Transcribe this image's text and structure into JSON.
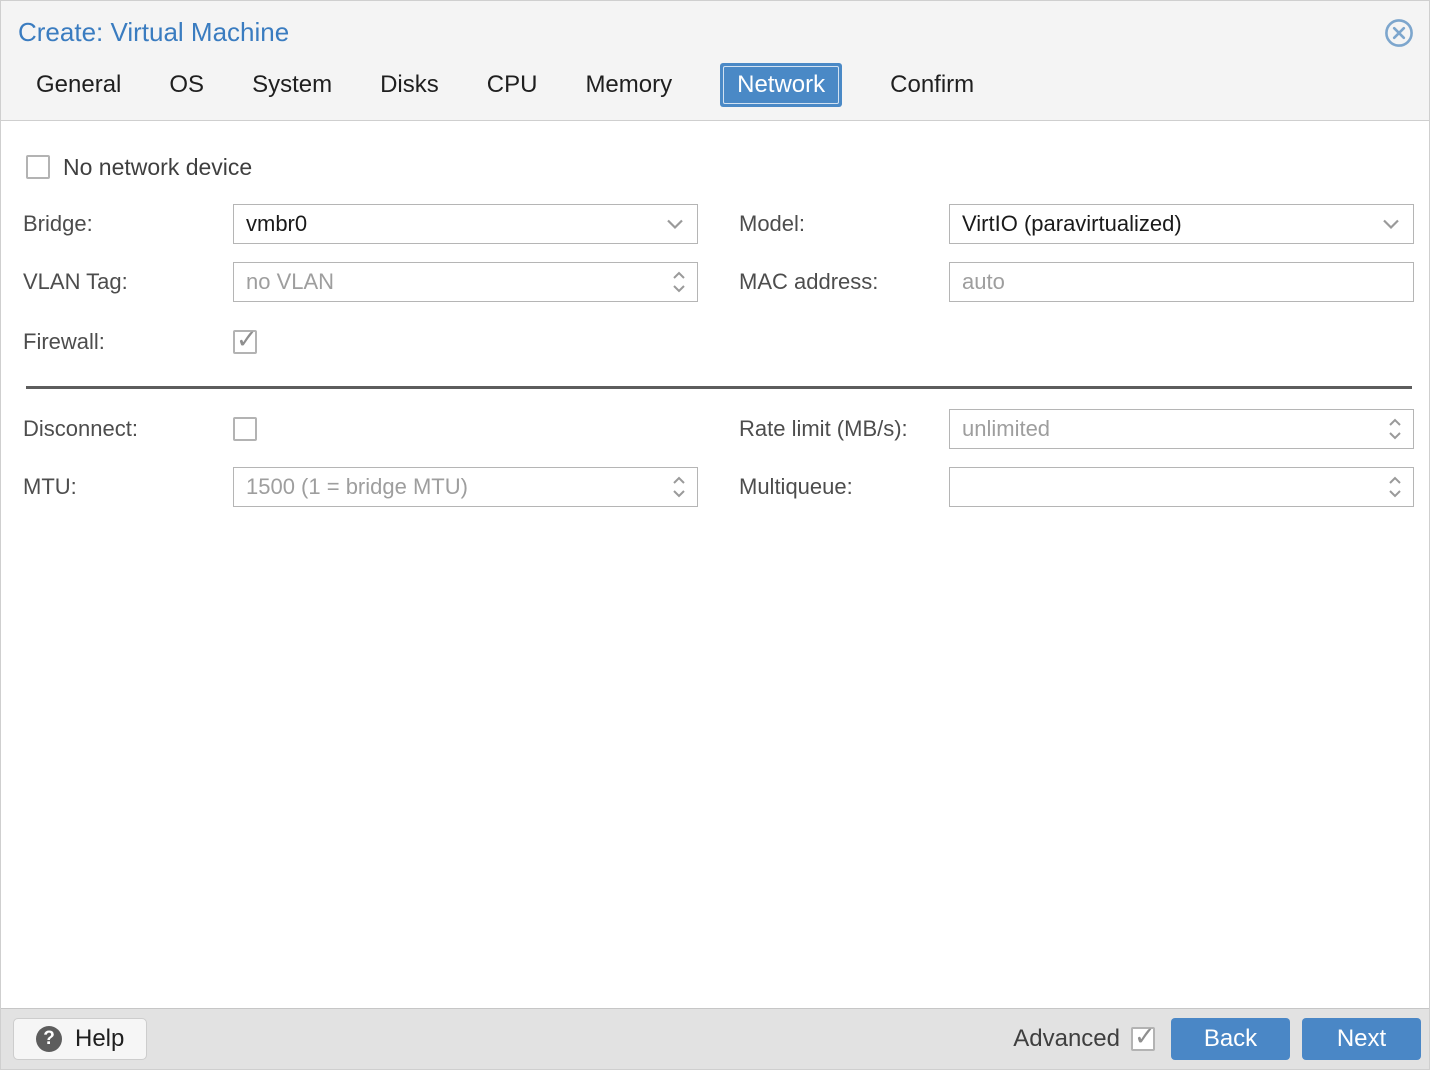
{
  "window": {
    "title": "Create: Virtual Machine"
  },
  "tabs": [
    {
      "label": "General",
      "active": false
    },
    {
      "label": "OS",
      "active": false
    },
    {
      "label": "System",
      "active": false
    },
    {
      "label": "Disks",
      "active": false
    },
    {
      "label": "CPU",
      "active": false
    },
    {
      "label": "Memory",
      "active": false
    },
    {
      "label": "Network",
      "active": true
    },
    {
      "label": "Confirm",
      "active": false
    }
  ],
  "form": {
    "no_network_device": {
      "label": "No network device",
      "checked": false
    },
    "bridge": {
      "label": "Bridge:",
      "value": "vmbr0"
    },
    "model": {
      "label": "Model:",
      "value": "VirtIO (paravirtualized)"
    },
    "vlan_tag": {
      "label": "VLAN Tag:",
      "value": "",
      "placeholder": "no VLAN"
    },
    "mac_address": {
      "label": "MAC address:",
      "value": "",
      "placeholder": "auto"
    },
    "firewall": {
      "label": "Firewall:",
      "checked": true
    },
    "disconnect": {
      "label": "Disconnect:",
      "checked": false
    },
    "rate_limit": {
      "label": "Rate limit (MB/s):",
      "value": "",
      "placeholder": "unlimited"
    },
    "mtu": {
      "label": "MTU:",
      "value": "",
      "placeholder": "1500 (1 = bridge MTU)"
    },
    "multiqueue": {
      "label": "Multiqueue:",
      "value": "",
      "placeholder": ""
    }
  },
  "footer": {
    "help_label": "Help",
    "help_icon_glyph": "?",
    "advanced_label": "Advanced",
    "advanced_checked": true,
    "back_label": "Back",
    "next_label": "Next"
  },
  "colors": {
    "accent_blue": "#4a87c6",
    "title_blue": "#3a7cc0",
    "close_icon_blue": "#7da6cd",
    "divider_gray": "#5d5d5d"
  }
}
